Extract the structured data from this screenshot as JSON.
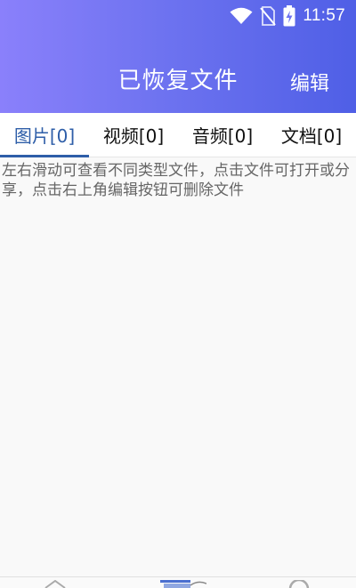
{
  "status_bar": {
    "time": "11:57",
    "icons": [
      "wifi-icon",
      "no-sim-icon",
      "battery-charging-icon"
    ]
  },
  "header": {
    "title": "已恢复文件",
    "edit_label": "编辑"
  },
  "tabs": [
    {
      "label": "图片[0]",
      "active": true
    },
    {
      "label": "视频[0]",
      "active": false
    },
    {
      "label": "音频[0]",
      "active": false
    },
    {
      "label": "文档[0]",
      "active": false
    }
  ],
  "hint": "左右滑动可查看不同类型文件，点击文件可打开或分享，点击右上角编辑按钮可删除文件",
  "colors": {
    "accent": "#2e5ea8",
    "header_start": "#8a80fb",
    "header_end": "#4f5fe6"
  },
  "bottom_nav": {
    "icons": [
      "chevron-up-icon",
      "files-icon",
      "search-icon"
    ]
  }
}
